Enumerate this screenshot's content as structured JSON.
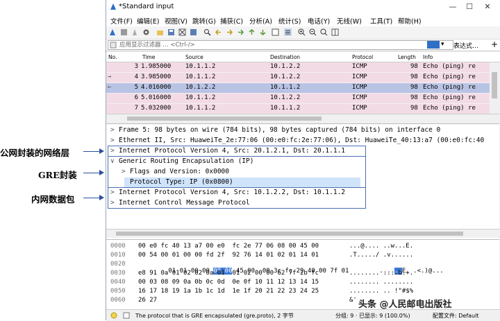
{
  "annotations": {
    "public_header": "公网封装的网络层",
    "gre_header": "GRE封装",
    "inner_packet": "内网数据包"
  },
  "window": {
    "title": "*Standard input",
    "minimize": "—",
    "maximize": "☐",
    "close": "✕"
  },
  "menu": [
    "文件(F)",
    "编辑(E)",
    "视图(V)",
    "跳转(G)",
    "捕获(C)",
    "分析(A)",
    "统计(S)",
    "电话(Y)",
    "无线(W)",
    "工具(T)",
    "帮助(H)"
  ],
  "filter": {
    "placeholder": "应用显示过滤器 … <Ctrl-/>",
    "expression_label": "表达式…",
    "dropdown_arrow": "▾",
    "plus": "+"
  },
  "packet_list": {
    "headers": [
      "No.",
      "Time",
      "Source",
      "Destination",
      "Protocol",
      "Length",
      "Info"
    ],
    "rows": [
      {
        "no": "3",
        "time": "1.985000",
        "src": "10.1.1.2",
        "dst": "10.1.2.2",
        "proto": "ICMP",
        "len": "98",
        "info": "Echo (ping) re",
        "marker": "",
        "selected": false
      },
      {
        "no": "4",
        "time": "3.985000",
        "src": "10.1.1.2",
        "dst": "10.1.2.2",
        "proto": "ICMP",
        "len": "98",
        "info": "Echo (ping) re",
        "marker": "→",
        "selected": false
      },
      {
        "no": "5",
        "time": "4.016000",
        "src": "10.1.2.2",
        "dst": "10.1.1.2",
        "proto": "ICMP",
        "len": "98",
        "info": "Echo (ping) re",
        "marker": "←",
        "selected": true
      },
      {
        "no": "6",
        "time": "5.016000",
        "src": "10.1.1.2",
        "dst": "10.1.2.2",
        "proto": "ICMP",
        "len": "98",
        "info": "Echo (ping) re",
        "marker": "",
        "selected": false
      },
      {
        "no": "7",
        "time": "5.032000",
        "src": "10.1.1.2",
        "dst": "10.1.1.2",
        "proto": "ICMP",
        "len": "98",
        "info": "Echo (ping) re",
        "marker": "",
        "selected": false
      }
    ]
  },
  "details": [
    {
      "caret": ">",
      "text": "Frame 5: 98 bytes on wire (784 bits), 98 bytes captured (784 bits) on interface 0"
    },
    {
      "caret": ">",
      "text": "Ethernet II, Src: HuaweiTe_2e:77:06 (00:e0:fc:2e:77:06), Dst: HuaweiTe_40:13:a7 (00:e0:fc:40"
    },
    {
      "caret": ">",
      "text": "Internet Protocol Version 4, Src: 20.1.2.1, Dst: 20.1.1.1"
    },
    {
      "caret": "∨",
      "text": "Generic Routing Encapsulation (IP)"
    },
    {
      "caret": ">",
      "text": "Flags and Version: 0x0000"
    },
    {
      "caret": "",
      "text": "Protocol Type: IP (0x0800)"
    },
    {
      "caret": ">",
      "text": "Internet Protocol Version 4, Src: 10.1.2.2, Dst: 10.1.1.2"
    },
    {
      "caret": ">",
      "text": "Internet Control Message Protocol"
    }
  ],
  "hex": [
    {
      "off": "0000",
      "bytes": "00 e0 fc 40 13 a7 00 e0  fc 2e 77 06 08 00 45 00",
      "ascii": "...@.... ..w...E."
    },
    {
      "off": "0010",
      "bytes": "00 54 00 01 00 00 fd 2f  92 76 14 01 02 01 14 01",
      "ascii": ".T...../ .v......"
    },
    {
      "off": "0020",
      "bytes_pre": "01 01 00 00 ",
      "bytes_hl": "08 00",
      "bytes_post": " 45 00  00 3c fc 29 40 00 7f 01",
      "ascii_pre": "....",
      "ascii_hl": "..",
      "ascii_post": "E. .<.)@..."
    },
    {
      "off": "0030",
      "bytes": "e8 91 0a 01 02 02 0a 01  01 02 00 00 62 7f 2b fc",
      "ascii": "........ ....b.+."
    },
    {
      "off": "0040",
      "bytes": "00 03 08 09 0a 0b 0c 0d  0e 0f 10 11 12 13 14 15",
      "ascii": "........ ........"
    },
    {
      "off": "0050",
      "bytes": "16 17 18 19 1a 1b 1c 1d  1e 1f 20 21 22 23 24 25",
      "ascii": "........ .. !\"#$%"
    },
    {
      "off": "0060",
      "bytes": "26 27",
      "ascii": "&'"
    }
  ],
  "status": {
    "message": "The protocol that is GRE encapsulated (gre.proto), 2 字节",
    "packets": "分组: 9 · 已显示: 9 (100.0%)",
    "profile": "配置文件: Default"
  },
  "watermark": "头条 @人民邮电出版社"
}
